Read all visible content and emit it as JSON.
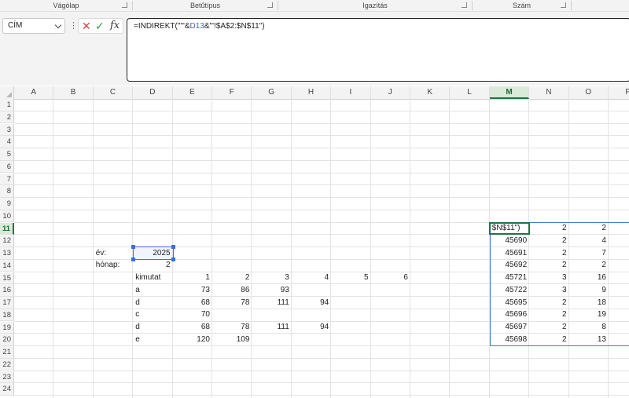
{
  "ribbon": {
    "groups": [
      {
        "label": "Vágólap"
      },
      {
        "label": "Betűtípus"
      },
      {
        "label": "Igazítás"
      },
      {
        "label": "Szám"
      }
    ]
  },
  "formula_bar": {
    "name_box": "CÍM",
    "cancel_icon": "✕",
    "enter_icon": "✓",
    "insert_function_icon": "fx",
    "formula_part1": "=INDIREKT(\"'\"&",
    "formula_ref": "D13",
    "formula_part2": "&\"'!$A$2:$N$11\")"
  },
  "grid": {
    "columns": [
      "A",
      "B",
      "C",
      "D",
      "E",
      "F",
      "G",
      "H",
      "I",
      "J",
      "K",
      "L",
      "M",
      "N",
      "O",
      "P"
    ],
    "active_column": "M",
    "rows": [
      "1",
      "2",
      "3",
      "4",
      "5",
      "6",
      "7",
      "8",
      "9",
      "10",
      "11",
      "12",
      "13",
      "14",
      "15",
      "16",
      "17",
      "18",
      "19",
      "20",
      "21",
      "22",
      "23",
      "24"
    ],
    "active_row": "11"
  },
  "cells": {
    "C13": "év:",
    "D13": "2025",
    "C14": "hónap:",
    "D14": "2",
    "D15": "kimutat",
    "E15": "1",
    "F15": "2",
    "G15": "3",
    "H15": "4",
    "I15": "5",
    "J15": "6",
    "D16": "a",
    "E16": "73",
    "F16": "86",
    "G16": "93",
    "D17": "d",
    "E17": "68",
    "F17": "78",
    "G17": "111",
    "H17": "94",
    "D18": "c",
    "E18": "70",
    "D19": "d",
    "E19": "68",
    "F19": "78",
    "G19": "111",
    "H19": "94",
    "D20": "e",
    "E20": "120",
    "F20": "109",
    "M11": "$N$11\")",
    "N11": "2",
    "O11": "2",
    "M12": "45690",
    "N12": "2",
    "O12": "4",
    "M13": "45691",
    "N13": "2",
    "O13": "7",
    "M14": "45692",
    "N14": "2",
    "O14": "2",
    "M15": "45721",
    "N15": "3",
    "O15": "16",
    "M16": "45722",
    "N16": "3",
    "O16": "9",
    "M17": "45695",
    "N17": "2",
    "O17": "18",
    "M18": "45696",
    "N18": "2",
    "O18": "19",
    "M19": "45697",
    "N19": "2",
    "O19": "8",
    "M20": "45698",
    "N20": "2",
    "O20": "13"
  }
}
